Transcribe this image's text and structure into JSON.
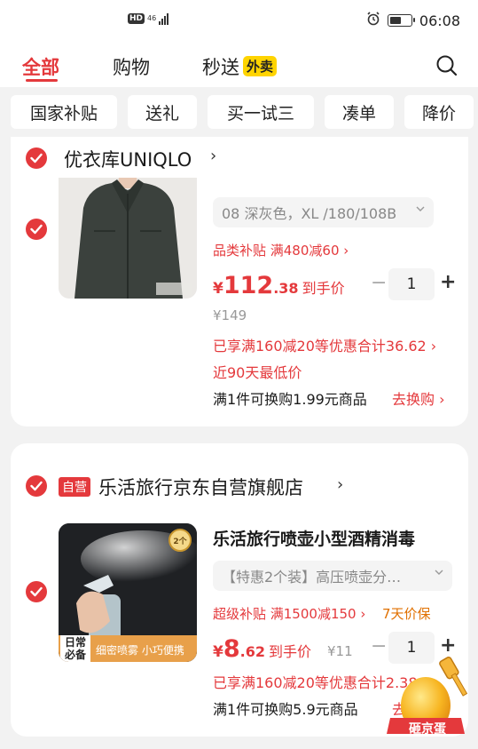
{
  "status_bar": {
    "hd": "HD",
    "network": "46",
    "time": "06:08",
    "battery_level": 0.55
  },
  "top_tabs": {
    "all": "全部",
    "shopping": "购物",
    "instant": "秒送",
    "takeout_badge": "外卖"
  },
  "filter_chips": [
    "国家补贴",
    "送礼",
    "买一试三",
    "凑单",
    "降价"
  ],
  "shop1": {
    "name": "优衣库UNIQLO",
    "chevron": "›",
    "product": {
      "sku": "08 深灰色，XL /180/108B",
      "subsidy": "品类补贴 满480减60",
      "price_int": "112",
      "price_dec": ".38",
      "price_suffix": "到手价",
      "currency": "¥",
      "quantity": "1",
      "original_price": "¥149",
      "discount": "已享满160减20等优惠合计36.62",
      "lowest": "近90天最低价",
      "trade_text": "满1件可换购1.99元商品",
      "trade_link": "去换购"
    }
  },
  "shop2": {
    "badge": "自营",
    "name": "乐活旅行京东自营旗舰店",
    "chevron": "›",
    "product": {
      "title": "乐活旅行喷壶小型酒精消毒",
      "sku": "【特惠2个装】高压喷壶分…",
      "subsidy": "超级补贴 满1500减150",
      "return_policy": "7天价保",
      "price_int": "8",
      "price_dec": ".62",
      "price_suffix": "到手价",
      "currency": "¥",
      "original_price": "¥11",
      "quantity": "1",
      "discount": "已享满160减20等优惠合计2.38",
      "trade_text": "满1件可换购5.9元商品",
      "trade_link": "去",
      "image_badge": "2个",
      "image_label": "日常\n必备",
      "image_caption": "细密喷雾 小巧便携"
    }
  },
  "float_egg": {
    "label": "砸京蛋"
  },
  "colors": {
    "accent": "#e4393c",
    "yellow": "#ffd400",
    "orange": "#e07000"
  }
}
